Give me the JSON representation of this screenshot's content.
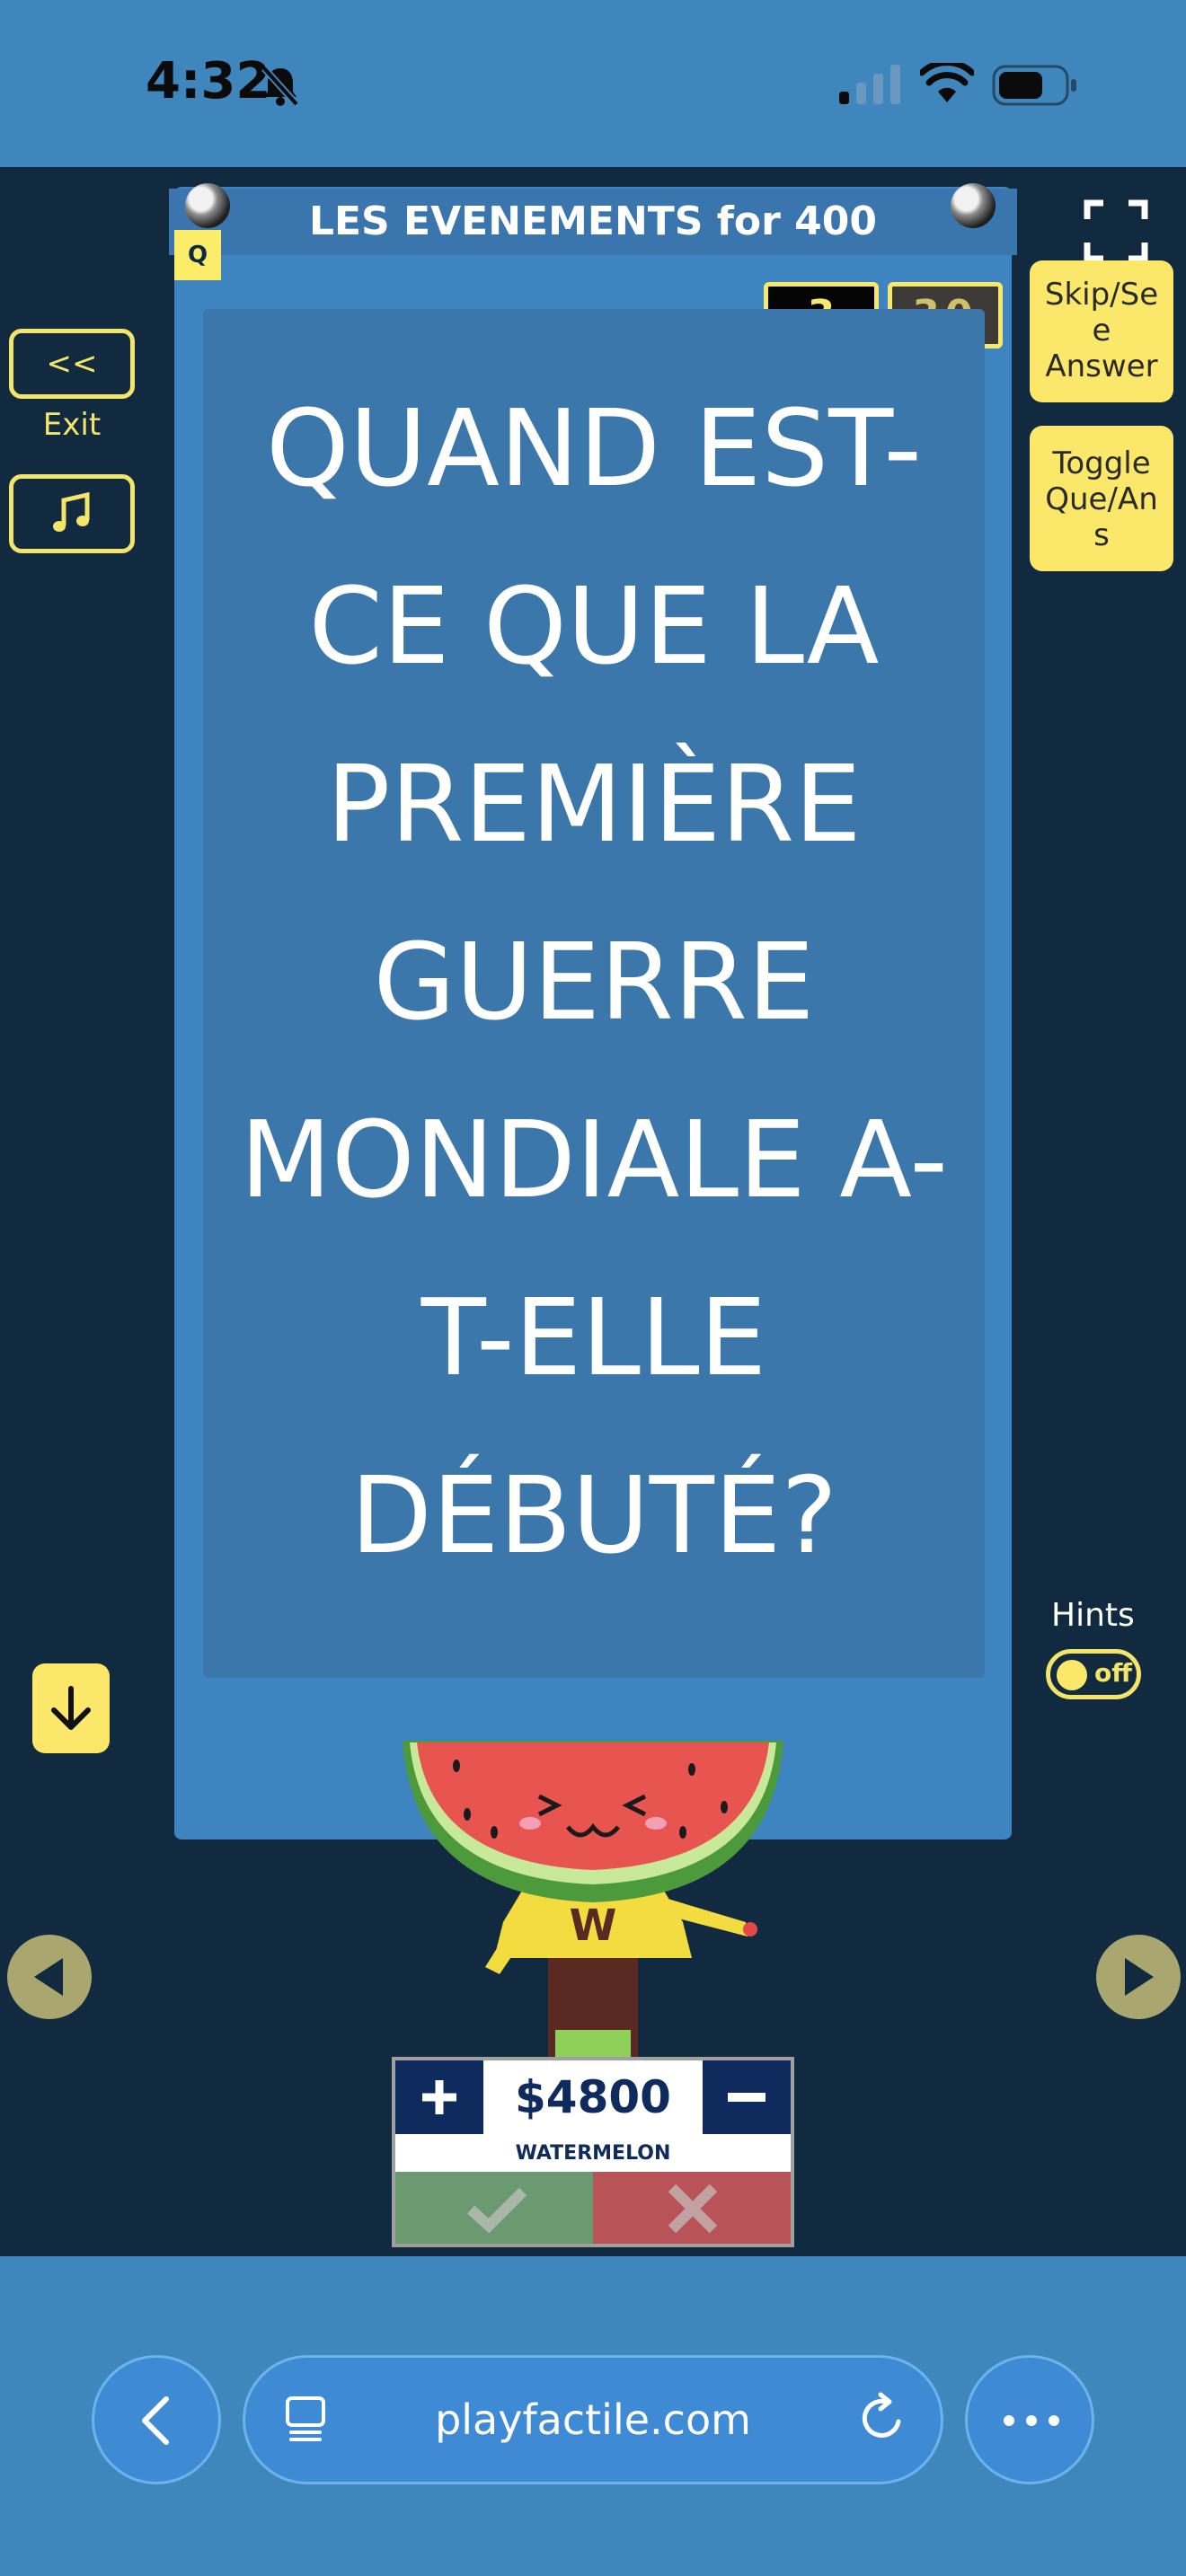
{
  "status_bar": {
    "time": "4:32",
    "icons": [
      "bell-slash-icon",
      "cellular-signal-icon",
      "wifi-icon",
      "battery-icon"
    ]
  },
  "game": {
    "category_title": "LES EVENEMENTS for 400",
    "q_badge": "Q",
    "timer_left": "3",
    "timer_right": "30",
    "question_lines": [
      "QUAND EST-",
      "CE QUE LA",
      "PREMIÈRE",
      "GUERRE",
      "MONDIALE A-",
      "T-ELLE",
      "DÉBUTÉ?"
    ]
  },
  "left_controls": {
    "exit_label": "<< Exit",
    "music_icon": "music-note-icon",
    "down_icon": "arrow-down-icon"
  },
  "right_controls": {
    "fullscreen_icon": "fullscreen-icon",
    "skip_lines": [
      "Skip/Se",
      "e",
      "Answer"
    ],
    "toggle_lines": [
      "Toggle",
      "Que/An",
      "s"
    ],
    "hints_label": "Hints",
    "hints_state": "off"
  },
  "navigation": {
    "prev_icon": "triangle-left-icon",
    "next_icon": "triangle-right-icon"
  },
  "team": {
    "avatar_letter": "W",
    "score": "$4800",
    "name": "WATERMELON"
  },
  "browser": {
    "url": "playfactile.com"
  },
  "colors": {
    "accent_yellow": "#fbe86a",
    "board_blue": "#3d84c0",
    "background_navy": "#122a3f",
    "score_navy": "#0f2a5c",
    "correct_green": "#6b9970",
    "wrong_red": "#b85458"
  }
}
